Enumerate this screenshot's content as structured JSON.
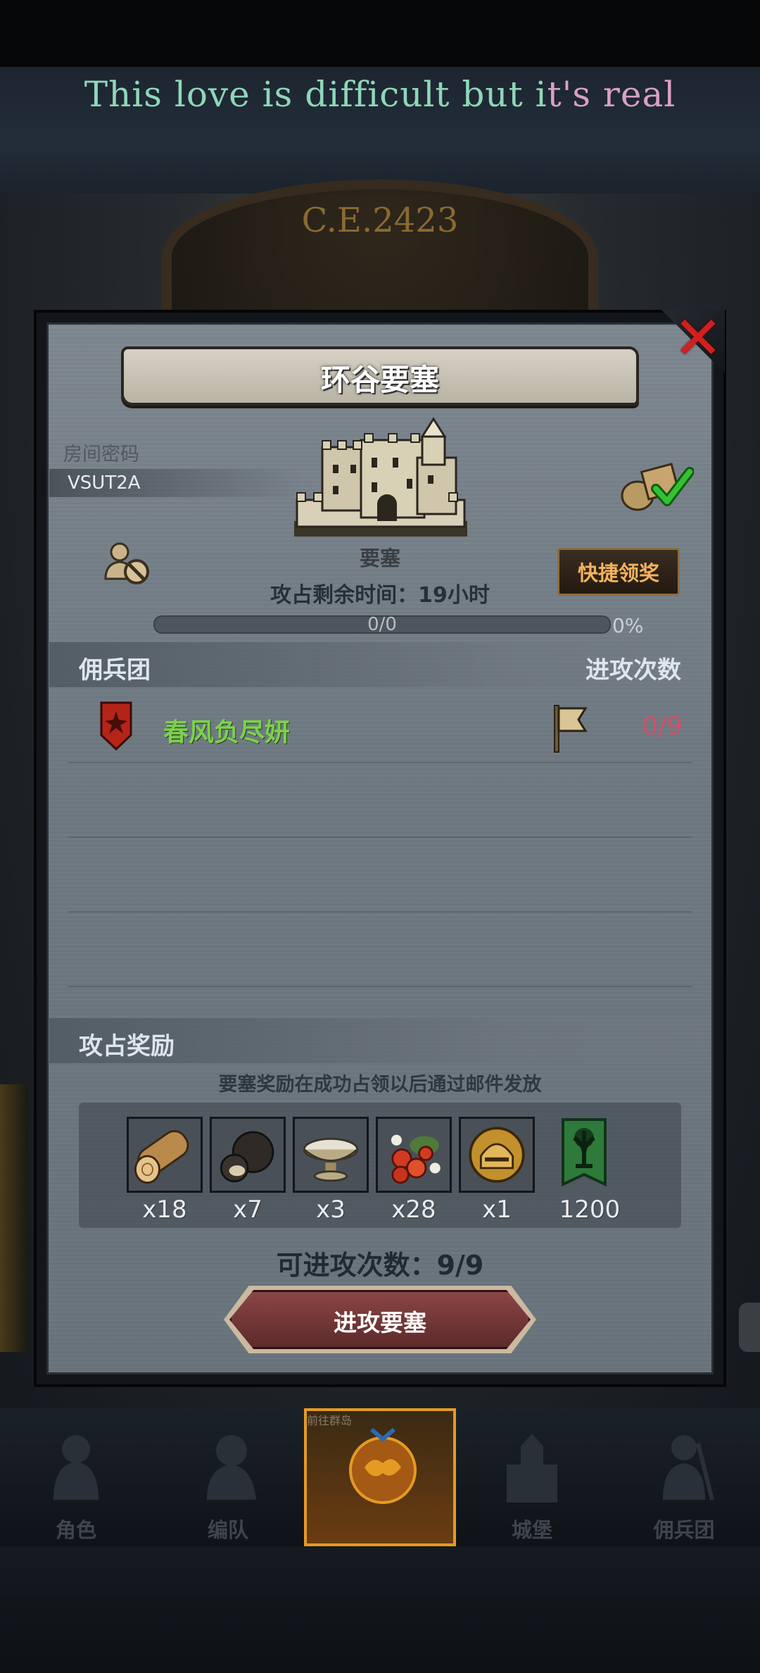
{
  "banner": {
    "text_part1": "This love is difficult but i",
    "text_part2": "t's real"
  },
  "scene": {
    "year": "C.E.2423"
  },
  "dialog": {
    "title": "环谷要塞",
    "room_code_label": "房间密码",
    "room_code": "VSUT2A",
    "building_label": "要塞",
    "quick_claim_label": "快捷领奖",
    "time_remaining": "攻占剩余时间：19小时",
    "progress": {
      "count_text": "0/0",
      "percent_text": "0%",
      "fraction": 0
    },
    "mercenary_header": "佣兵团",
    "attack_count_header": "进攻次数",
    "guild": {
      "name": "春风负尽妍",
      "attack_count": "0/9"
    },
    "reward_header": "攻占奖励",
    "reward_note": "要塞奖励在成功占领以后通过邮件发放",
    "rewards": [
      {
        "icon": "wood-log-icon",
        "qty": "x18"
      },
      {
        "icon": "truffle-icon",
        "qty": "x7"
      },
      {
        "icon": "silver-bowl-icon",
        "qty": "x3"
      },
      {
        "icon": "berries-icon",
        "qty": "x28"
      },
      {
        "icon": "golden-helmet-icon",
        "qty": "x1"
      },
      {
        "icon": "guild-banner-icon",
        "qty": "1200"
      }
    ],
    "remaining_attacks": "可进攻次数：9/9",
    "attack_button": "进攻要塞"
  },
  "nav": {
    "items": [
      {
        "label": "角色",
        "icon": "character-icon"
      },
      {
        "label": "编队",
        "icon": "formation-icon"
      },
      {
        "label": "前往群岛",
        "icon": "islands-icon"
      },
      {
        "label": "城堡",
        "icon": "castle-icon"
      },
      {
        "label": "佣兵团",
        "icon": "mercenary-icon"
      }
    ],
    "active_index": 2
  },
  "colors": {
    "accent_orange": "#e59a24",
    "guild_green": "#7cd14e",
    "attack_count_red": "#d1516a",
    "close_red": "#d21f1f"
  }
}
